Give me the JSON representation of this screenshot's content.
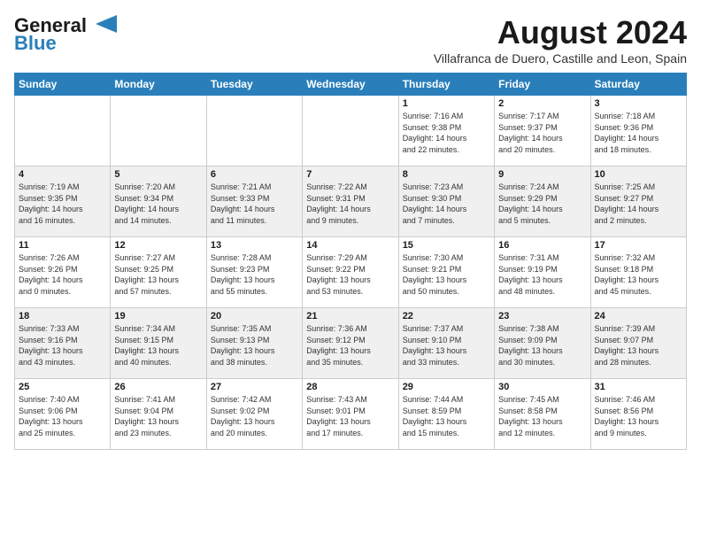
{
  "header": {
    "logo_general": "General",
    "logo_blue": "Blue",
    "month_year": "August 2024",
    "location": "Villafranca de Duero, Castille and Leon, Spain"
  },
  "days_of_week": [
    "Sunday",
    "Monday",
    "Tuesday",
    "Wednesday",
    "Thursday",
    "Friday",
    "Saturday"
  ],
  "weeks": [
    [
      {
        "day": "",
        "info": ""
      },
      {
        "day": "",
        "info": ""
      },
      {
        "day": "",
        "info": ""
      },
      {
        "day": "",
        "info": ""
      },
      {
        "day": "1",
        "info": "Sunrise: 7:16 AM\nSunset: 9:38 PM\nDaylight: 14 hours\nand 22 minutes."
      },
      {
        "day": "2",
        "info": "Sunrise: 7:17 AM\nSunset: 9:37 PM\nDaylight: 14 hours\nand 20 minutes."
      },
      {
        "day": "3",
        "info": "Sunrise: 7:18 AM\nSunset: 9:36 PM\nDaylight: 14 hours\nand 18 minutes."
      }
    ],
    [
      {
        "day": "4",
        "info": "Sunrise: 7:19 AM\nSunset: 9:35 PM\nDaylight: 14 hours\nand 16 minutes."
      },
      {
        "day": "5",
        "info": "Sunrise: 7:20 AM\nSunset: 9:34 PM\nDaylight: 14 hours\nand 14 minutes."
      },
      {
        "day": "6",
        "info": "Sunrise: 7:21 AM\nSunset: 9:33 PM\nDaylight: 14 hours\nand 11 minutes."
      },
      {
        "day": "7",
        "info": "Sunrise: 7:22 AM\nSunset: 9:31 PM\nDaylight: 14 hours\nand 9 minutes."
      },
      {
        "day": "8",
        "info": "Sunrise: 7:23 AM\nSunset: 9:30 PM\nDaylight: 14 hours\nand 7 minutes."
      },
      {
        "day": "9",
        "info": "Sunrise: 7:24 AM\nSunset: 9:29 PM\nDaylight: 14 hours\nand 5 minutes."
      },
      {
        "day": "10",
        "info": "Sunrise: 7:25 AM\nSunset: 9:27 PM\nDaylight: 14 hours\nand 2 minutes."
      }
    ],
    [
      {
        "day": "11",
        "info": "Sunrise: 7:26 AM\nSunset: 9:26 PM\nDaylight: 14 hours\nand 0 minutes."
      },
      {
        "day": "12",
        "info": "Sunrise: 7:27 AM\nSunset: 9:25 PM\nDaylight: 13 hours\nand 57 minutes."
      },
      {
        "day": "13",
        "info": "Sunrise: 7:28 AM\nSunset: 9:23 PM\nDaylight: 13 hours\nand 55 minutes."
      },
      {
        "day": "14",
        "info": "Sunrise: 7:29 AM\nSunset: 9:22 PM\nDaylight: 13 hours\nand 53 minutes."
      },
      {
        "day": "15",
        "info": "Sunrise: 7:30 AM\nSunset: 9:21 PM\nDaylight: 13 hours\nand 50 minutes."
      },
      {
        "day": "16",
        "info": "Sunrise: 7:31 AM\nSunset: 9:19 PM\nDaylight: 13 hours\nand 48 minutes."
      },
      {
        "day": "17",
        "info": "Sunrise: 7:32 AM\nSunset: 9:18 PM\nDaylight: 13 hours\nand 45 minutes."
      }
    ],
    [
      {
        "day": "18",
        "info": "Sunrise: 7:33 AM\nSunset: 9:16 PM\nDaylight: 13 hours\nand 43 minutes."
      },
      {
        "day": "19",
        "info": "Sunrise: 7:34 AM\nSunset: 9:15 PM\nDaylight: 13 hours\nand 40 minutes."
      },
      {
        "day": "20",
        "info": "Sunrise: 7:35 AM\nSunset: 9:13 PM\nDaylight: 13 hours\nand 38 minutes."
      },
      {
        "day": "21",
        "info": "Sunrise: 7:36 AM\nSunset: 9:12 PM\nDaylight: 13 hours\nand 35 minutes."
      },
      {
        "day": "22",
        "info": "Sunrise: 7:37 AM\nSunset: 9:10 PM\nDaylight: 13 hours\nand 33 minutes."
      },
      {
        "day": "23",
        "info": "Sunrise: 7:38 AM\nSunset: 9:09 PM\nDaylight: 13 hours\nand 30 minutes."
      },
      {
        "day": "24",
        "info": "Sunrise: 7:39 AM\nSunset: 9:07 PM\nDaylight: 13 hours\nand 28 minutes."
      }
    ],
    [
      {
        "day": "25",
        "info": "Sunrise: 7:40 AM\nSunset: 9:06 PM\nDaylight: 13 hours\nand 25 minutes."
      },
      {
        "day": "26",
        "info": "Sunrise: 7:41 AM\nSunset: 9:04 PM\nDaylight: 13 hours\nand 23 minutes."
      },
      {
        "day": "27",
        "info": "Sunrise: 7:42 AM\nSunset: 9:02 PM\nDaylight: 13 hours\nand 20 minutes."
      },
      {
        "day": "28",
        "info": "Sunrise: 7:43 AM\nSunset: 9:01 PM\nDaylight: 13 hours\nand 17 minutes."
      },
      {
        "day": "29",
        "info": "Sunrise: 7:44 AM\nSunset: 8:59 PM\nDaylight: 13 hours\nand 15 minutes."
      },
      {
        "day": "30",
        "info": "Sunrise: 7:45 AM\nSunset: 8:58 PM\nDaylight: 13 hours\nand 12 minutes."
      },
      {
        "day": "31",
        "info": "Sunrise: 7:46 AM\nSunset: 8:56 PM\nDaylight: 13 hours\nand 9 minutes."
      }
    ]
  ]
}
